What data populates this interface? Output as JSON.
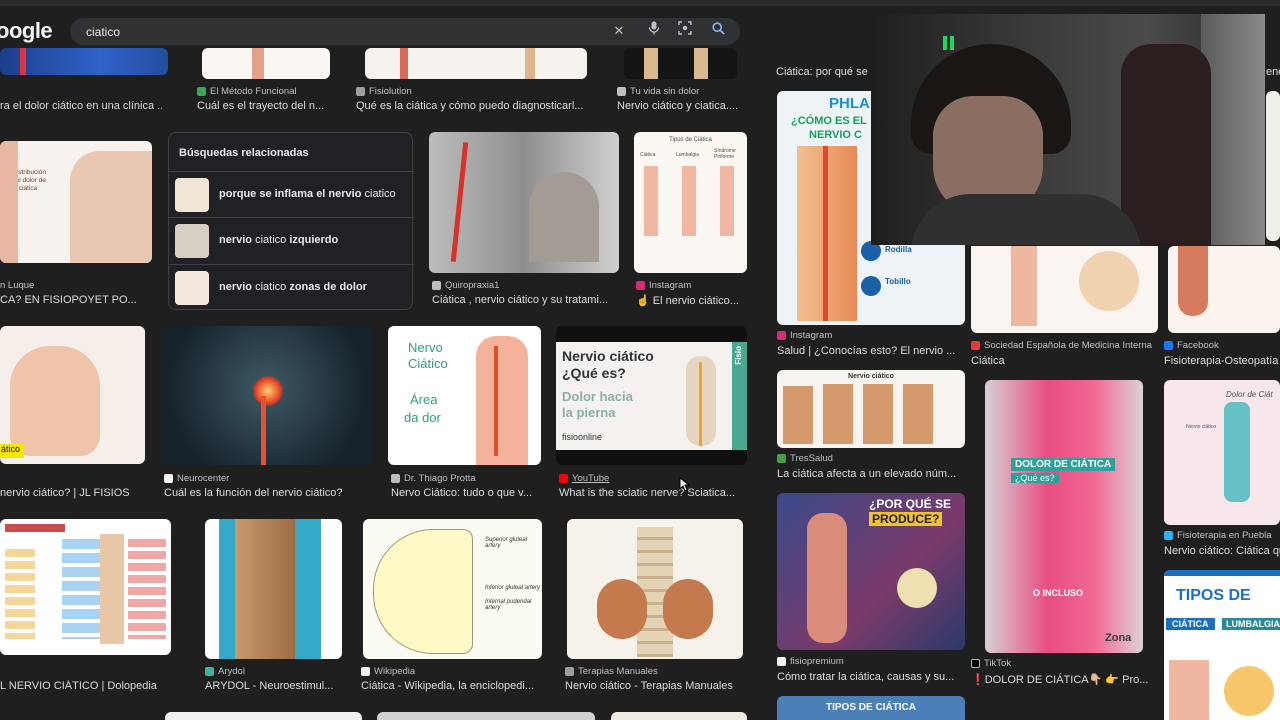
{
  "logo": "oogle",
  "search": {
    "query": "ciatico"
  },
  "related": {
    "title": "Búsquedas relacionadas",
    "items": [
      {
        "pre": "porque se inflama el nervio ",
        "normal": "ciatico",
        "post": ""
      },
      {
        "pre": "nervio ",
        "normal": "ciatico",
        "post": " izquierdo"
      },
      {
        "pre": "nervio ",
        "normal": "ciatico",
        "post": " zonas de dolor"
      }
    ]
  },
  "row0": [
    {
      "source": "",
      "title": "ra el dolor ciático en una clínica ..."
    },
    {
      "source": "El Método Funcional",
      "title": "Cuál es el trayecto del n..."
    },
    {
      "source": "Fisiolution",
      "title": "Qué es la ciática y cómo puedo diagnosticarl..."
    },
    {
      "source": "Tu vida sin dolor",
      "title": "Nervio ciático y ciatica...."
    }
  ],
  "row1": [
    {
      "source": "n Luque",
      "title": "CA? EN FISIOPOYET PO...",
      "img_text": "Distribución del dolor de la ciática"
    },
    {
      "source": "Quiropraxia1",
      "title": "Ciática , nervio ciático y su tratami..."
    },
    {
      "source": "Instagram",
      "title": "☝ El nervio ciático...",
      "img_text": "Tipos de Ciática",
      "img_labels": [
        "Ciática",
        "Lumbalgia",
        "Síndrome Piriforme"
      ]
    }
  ],
  "row2": [
    {
      "source": "",
      "title": "nervio ciático? | JL FISIOS",
      "img_label": "ático"
    },
    {
      "source": "Neurocenter",
      "title": "Cuál es la función del nervio ciático?"
    },
    {
      "source": "Dr. Thiago Protta",
      "title": "Nervo Ciático: tudo o que v...",
      "img_lines": [
        "Nervo",
        "Ciático",
        "Área",
        "da dor"
      ]
    },
    {
      "source": "YouTube",
      "title": "What is the sciatic nerve? Sciatica...",
      "img_lines": [
        "Nervio ciático",
        "¿Qué es?",
        "Dolor hacia",
        "la pierna",
        "fisioonline",
        "Fisio"
      ]
    }
  ],
  "row3": [
    {
      "source": "",
      "title": "L NERVIO CIÁTICO | Dolopedia"
    },
    {
      "source": "Arydol",
      "title": "ARYDOL - Neuroestimul..."
    },
    {
      "source": "Wikipedia",
      "title": "Ciática - Wikipedia, la enciclopedi...",
      "img_lines": [
        "Superior gluteal artery",
        "Inferior gluteal artery",
        "Internal pudendal artery"
      ]
    },
    {
      "source": "Terapias Manuales",
      "title": "Nervio ciático - Terapias Manuales"
    }
  ],
  "right": {
    "header": "Ciática: por qué se",
    "header_tail": "ene",
    "cards": [
      {
        "source": "Instagram",
        "title": "Salud | ¿Conocías esto? El nervio ...",
        "img_lines": [
          "PHLA",
          "¿CÓMO ES EL",
          "NERVIO C",
          "Rodilla",
          "Tobillo"
        ]
      },
      {
        "source": "Sociedad Española de Medicina Interna",
        "title": "Ciática"
      },
      {
        "source": "Facebook",
        "title": "Fisioterapia-Osteopatía"
      },
      {
        "source": "TresSalud",
        "title": "La ciática afecta a un elevado núm...",
        "img_lines": [
          "Nervio ciático"
        ]
      },
      {
        "source": "fisiopremium",
        "title": "Cómo tratar la ciática, causas y su...",
        "img_lines": [
          "¿POR QUÉ SE",
          "PRODUCE?"
        ]
      },
      {
        "source": "TikTok",
        "title": "❗DOLOR DE CIÁTICA👇🏼 👉 Pro...",
        "img_lines": [
          "DOLOR DE CIÁTICA",
          "¿Qué es?",
          "O INCLUSO",
          "Zona"
        ]
      },
      {
        "source": "Fisioterapia en Puebla",
        "title": "Nervio ciático: Ciática qu",
        "img_lines": [
          "Dolor de Ciát",
          "Nervio ciático"
        ]
      },
      {
        "source": "",
        "title": "",
        "img_lines": [
          "TIPOS DE CIÁTICA"
        ]
      },
      {
        "source": "",
        "title": "",
        "img_lines": [
          "TIPOS DE",
          "CIÁTICA",
          "LUMBALGIA"
        ]
      }
    ]
  },
  "colors": {
    "bg": "#1f1f1f",
    "pause": "#1ed760"
  }
}
